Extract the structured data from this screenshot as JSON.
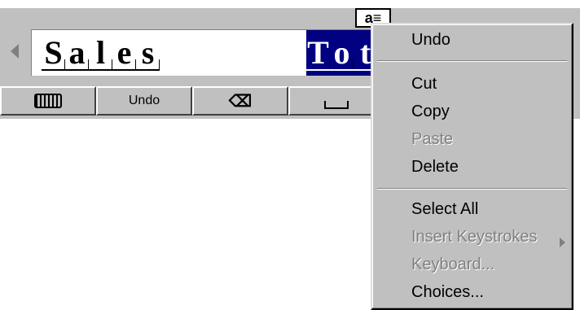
{
  "input": {
    "plain_chars": [
      "S",
      "a",
      "l",
      "e",
      "s"
    ],
    "selected_chars": [
      "T",
      "o",
      "t"
    ],
    "caret_handle": "a≡"
  },
  "toolbar": {
    "keyboard_icon": "keyboard-icon",
    "undo_label": "Undo",
    "backspace_glyph": "⌫",
    "space_icon": "space-icon"
  },
  "context_menu": {
    "undo": "Undo",
    "cut": "Cut",
    "copy": "Copy",
    "paste": "Paste",
    "delete": "Delete",
    "select_all": "Select All",
    "insert_keystrokes": "Insert Keystrokes",
    "keyboard": "Keyboard...",
    "choices": "Choices..."
  },
  "colors": {
    "selection": "#000080",
    "face": "#c0c0c0",
    "disabled": "#808080"
  }
}
